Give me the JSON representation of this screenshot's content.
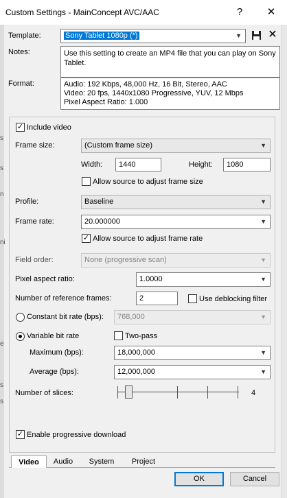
{
  "window": {
    "title": "Custom Settings - MainConcept AVC/AAC",
    "help": "?",
    "close": "✕"
  },
  "background_fragments": [
    "s",
    "s",
    "n",
    "ni",
    "e",
    "s",
    "s"
  ],
  "header": {
    "template_label": "Template:",
    "template_value": "Sony Tablet 1080p (*)",
    "notes_label": "Notes:",
    "notes_text": "Use this setting to create an MP4 file that you can play on Sony Tablet.",
    "format_label": "Format:",
    "format_lines": [
      "Audio: 192 Kbps, 48,000 Hz, 16 Bit, Stereo, AAC",
      "Video: 20 fps, 1440x1080 Progressive, YUV, 12 Mbps",
      "Pixel Aspect Ratio: 1.000"
    ]
  },
  "video": {
    "include_video_label": "Include video",
    "include_video_checked": true,
    "frame_size_label": "Frame size:",
    "frame_size_value": "(Custom frame size)",
    "width_label": "Width:",
    "width_value": "1440",
    "height_label": "Height:",
    "height_value": "1080",
    "allow_size_label": "Allow source to adjust frame size",
    "allow_size_checked": false,
    "profile_label": "Profile:",
    "profile_value": "Baseline",
    "frame_rate_label": "Frame rate:",
    "frame_rate_value": "20.000000",
    "allow_rate_label": "Allow source to adjust frame rate",
    "allow_rate_checked": true,
    "field_order_label": "Field order:",
    "field_order_value": "None (progressive scan)",
    "par_label": "Pixel aspect ratio:",
    "par_value": "1.0000",
    "ref_frames_label": "Number of reference frames:",
    "ref_frames_value": "2",
    "deblock_label": "Use deblocking filter",
    "deblock_checked": false,
    "cbr_label": "Constant bit rate (bps):",
    "cbr_value": "768,000",
    "vbr_label": "Variable bit rate",
    "vbr_selected": true,
    "two_pass_label": "Two-pass",
    "two_pass_checked": false,
    "max_label": "Maximum (bps):",
    "max_value": "18,000,000",
    "avg_label": "Average (bps):",
    "avg_value": "12,000,000",
    "slices_label": "Number of slices:",
    "slices_value": "4",
    "slices_fraction": 0.0,
    "progressive_label": "Enable progressive download",
    "progressive_checked": true
  },
  "tabs": [
    "Video",
    "Audio",
    "System",
    "Project"
  ],
  "buttons": {
    "ok": "OK",
    "cancel": "Cancel"
  }
}
